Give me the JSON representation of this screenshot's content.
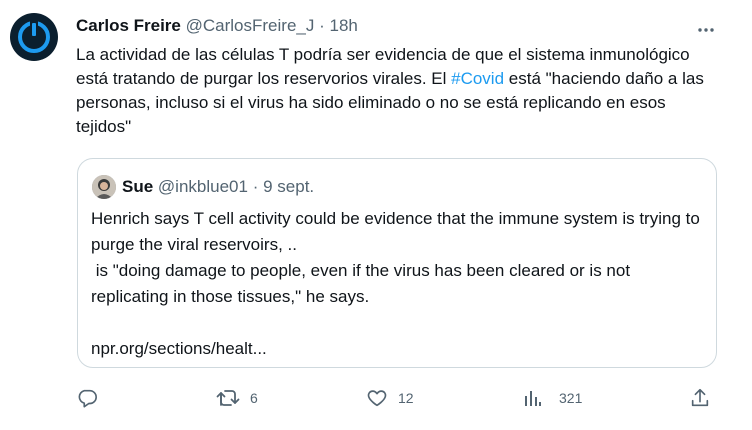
{
  "tweet": {
    "author_name": "Carlos Freire",
    "author_handle": "@CarlosFreire_J",
    "separator": "·",
    "time": "18h",
    "text_part1": "La actividad de las células T podría ser evidencia de que el sistema inmunológico está tratando de purgar los reservorios virales. El ",
    "hashtag": "#Covid",
    "text_part2": " está \"haciendo daño a las personas, incluso si el virus ha sido eliminado o no se está replicando en esos tejidos\""
  },
  "quoted": {
    "author_name": "Sue",
    "author_handle": "@inkblue01",
    "separator": "·",
    "time": "9 sept.",
    "text": "Henrich says T cell activity could be evidence that the immune system is trying to purge the viral reservoirs, ..\n is \"doing damage to people, even if the virus has been cleared or is not replicating in those tissues,\" he says.\n\nnpr.org/sections/healt..."
  },
  "actions": {
    "reply_icon": "reply-icon",
    "retweet_icon": "retweet-icon",
    "retweet_count": "6",
    "like_icon": "heart-icon",
    "like_count": "12",
    "views_icon": "views-icon",
    "views_count": "321",
    "share_icon": "share-icon"
  },
  "colors": {
    "text": "#0f1419",
    "secondary": "#536471",
    "link": "#1d9bf0",
    "border": "#cfd9de"
  }
}
